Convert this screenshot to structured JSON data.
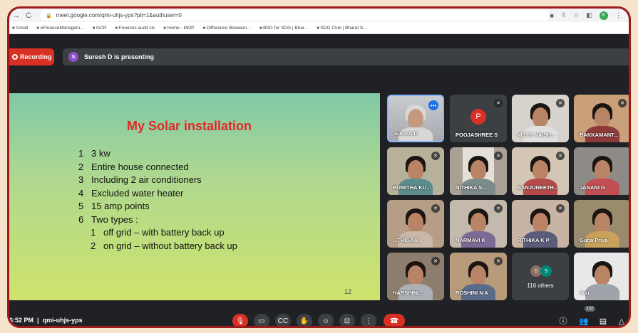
{
  "browser": {
    "url": "meet.google.com/qmi-uhjs-yps?pli=1&authuser=0",
    "profile_initial": "K",
    "bookmarks": [
      "Gmail",
      "eFinanceManagem...",
      "GCR",
      "Forensic audit cls",
      "Home - MOP",
      "Difference Between...",
      "BSG for SDG | Bhar...",
      "SDG Club | Bharat S..."
    ]
  },
  "meet": {
    "recording_label": "Recording",
    "presenter_initial": "S",
    "presenting_text": "Suresh D is presenting",
    "meeting_time": "6:52 PM",
    "meeting_code": "qmi-uhjs-yps",
    "participants_count": "132"
  },
  "slide": {
    "title": "My Solar installation",
    "items": [
      {
        "n": "1",
        "text": "3 kw"
      },
      {
        "n": "2",
        "text": "Entire house connected"
      },
      {
        "n": "3",
        "text": "Including 2 air conditioners"
      },
      {
        "n": "4",
        "text": "Excluded water heater"
      },
      {
        "n": "5",
        "text": "15 amp points"
      },
      {
        "n": "6",
        "text": "Two types :"
      }
    ],
    "subitems": [
      {
        "n": "1",
        "text": "off grid – with battery back up"
      },
      {
        "n": "2",
        "text": "on grid – without battery back up"
      }
    ],
    "page_number": "12"
  },
  "participants": [
    {
      "name": "Suresh D"
    },
    {
      "name": "POOJASHREE S",
      "initial": "P"
    },
    {
      "name": "M.O.P. VAISH..."
    },
    {
      "name": "BAKKAMANT..."
    },
    {
      "name": "RUMITHA KU..."
    },
    {
      "name": "NITHIKA S..."
    },
    {
      "name": "SANJUNEETH..."
    },
    {
      "name": "JANANI G"
    },
    {
      "name": "...THIGAA..."
    },
    {
      "name": "NARMAVI K"
    },
    {
      "name": "RITHIKA K P"
    },
    {
      "name": "Guga Priya"
    },
    {
      "name": "HARSHINI..."
    },
    {
      "name": "ROSHINI N A"
    },
    {
      "name": "You"
    }
  ],
  "others": {
    "label": "116 others",
    "initials": [
      "D",
      "S"
    ]
  },
  "colors": {
    "accent_red": "#d93025",
    "slide_title": "#e02828",
    "bg_dark": "#202124"
  }
}
